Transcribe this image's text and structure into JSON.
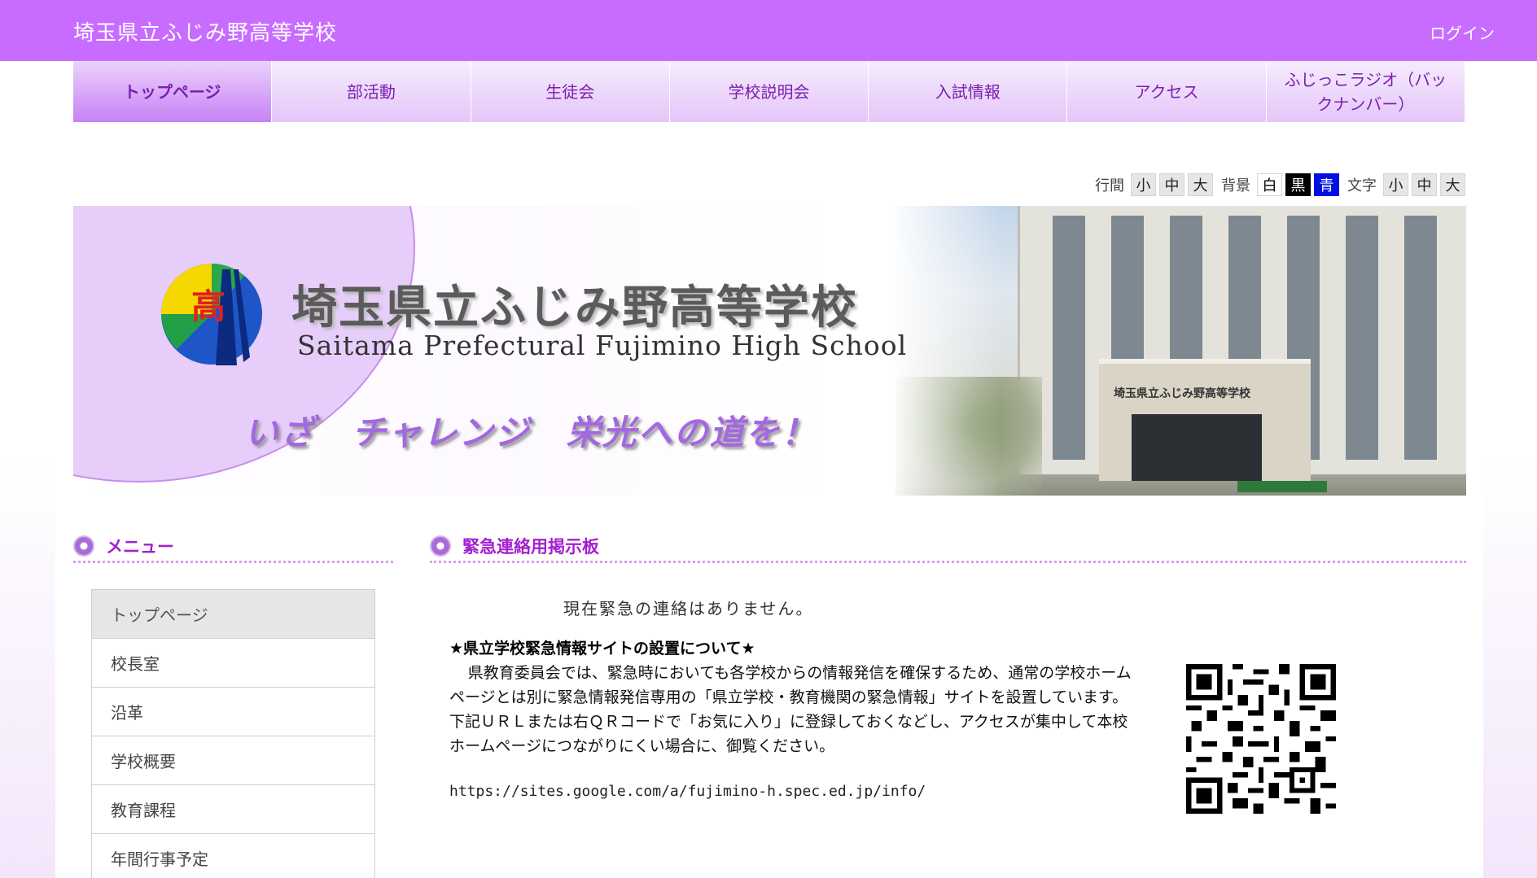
{
  "header": {
    "site_title": "埼玉県立ふじみ野高等学校",
    "login_label": "ログイン"
  },
  "nav": {
    "items": [
      {
        "label": "トップページ",
        "active": true
      },
      {
        "label": "部活動"
      },
      {
        "label": "生徒会"
      },
      {
        "label": "学校説明会"
      },
      {
        "label": "入試情報"
      },
      {
        "label": "アクセス"
      },
      {
        "label": "ふじっこラジオ（バックナンバー）"
      }
    ]
  },
  "accessibility": {
    "line_spacing_label": "行間",
    "background_label": "背景",
    "text_label": "文字",
    "small": "小",
    "medium": "中",
    "large": "大",
    "white": "白",
    "black": "黒",
    "blue": "青"
  },
  "banner": {
    "title_ja": "埼玉県立ふじみ野高等学校",
    "title_en": "Saitama Prefectural Fujimino High School",
    "slogan": "いざ　チャレンジ　栄光への道を！",
    "logo_char": "高",
    "building_sign": "埼玉県立ふじみ野高等学校"
  },
  "sidebar": {
    "heading": "メニュー",
    "items": [
      {
        "label": "トップページ",
        "active": true
      },
      {
        "label": "校長室"
      },
      {
        "label": "沿革"
      },
      {
        "label": "学校概要"
      },
      {
        "label": "教育課程"
      },
      {
        "label": "年間行事予定"
      }
    ]
  },
  "main": {
    "heading": "緊急連絡用掲示板",
    "no_emergency": "現在緊急の連絡はありません。",
    "notice_title": "★県立学校緊急情報サイトの設置について★",
    "notice_body": "県教育委員会では、緊急時においても各学校からの情報発信を確保するため、通常の学校ホームページとは別に緊急情報発信専用の「県立学校・教育機関の緊急情報」サイトを設置しています。下記ＵＲＬまたは右ＱＲコードで「お気に入り」に登録しておくなどし、アクセスが集中して本校ホームページにつながりにくい場合に、御覧ください。",
    "notice_url": "https://sites.google.com/a/fujimino-h.spec.ed.jp/info/"
  },
  "colors": {
    "accent": "#c86cff",
    "heading": "#a41fd0",
    "nav_text": "#7a1fb0"
  }
}
